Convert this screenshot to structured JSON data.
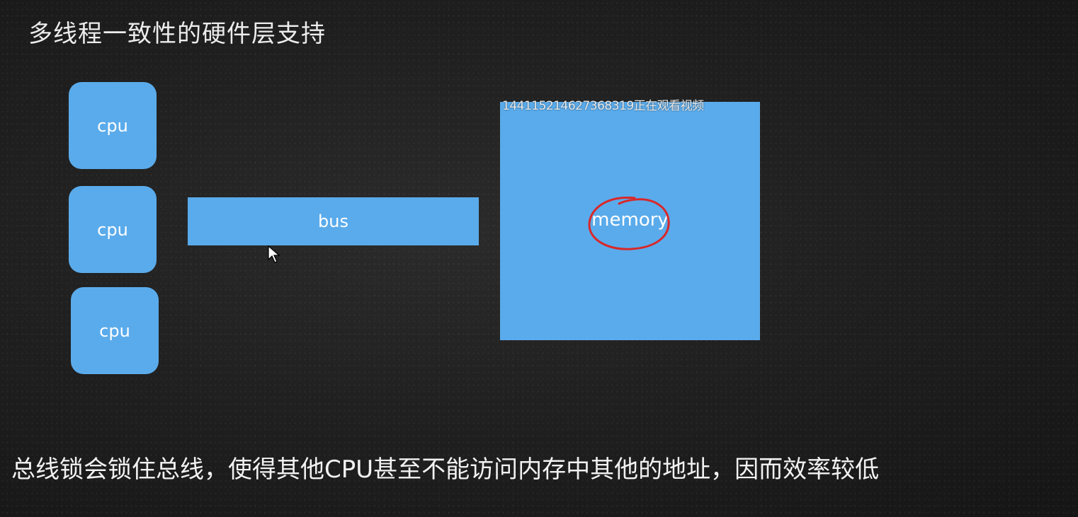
{
  "title": "多线程一致性的硬件层支持",
  "cpus": [
    {
      "label": "cpu"
    },
    {
      "label": "cpu"
    },
    {
      "label": "cpu"
    }
  ],
  "bus": {
    "label": "bus"
  },
  "memory": {
    "label": "memory",
    "highlight_color": "#d8282a"
  },
  "watermark": "14411521462736831​9正在观看视频",
  "caption": "总线锁会锁住总线，使得其他CPU甚至不能访问内存中其他的地址，因而效率较低",
  "colors": {
    "block": "#5aabeb",
    "background": "#1e1e1e",
    "text": "#ffffff"
  }
}
